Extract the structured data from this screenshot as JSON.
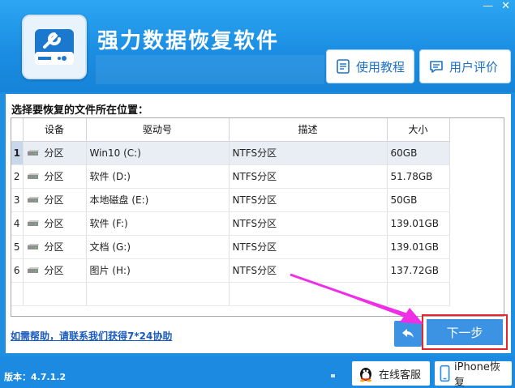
{
  "app": {
    "title": "强力数据恢复软件",
    "version": "版本：4.7.1.2"
  },
  "header": {
    "tutorial_label": "使用教程",
    "review_label": "用户评价"
  },
  "main": {
    "prompt": "选择要恢复的文件所在位置：",
    "columns": [
      "设备",
      "驱动号",
      "描述",
      "大小"
    ],
    "rows": [
      {
        "num": "1",
        "device": "分区",
        "drive": "Win10 (C:)",
        "desc": "NTFS分区",
        "size": "60GB"
      },
      {
        "num": "2",
        "device": "分区",
        "drive": "软件 (D:)",
        "desc": "NTFS分区",
        "size": "51.78GB"
      },
      {
        "num": "3",
        "device": "分区",
        "drive": "本地磁盘 (E:)",
        "desc": "NTFS分区",
        "size": "50GB"
      },
      {
        "num": "4",
        "device": "分区",
        "drive": "软件 (F:)",
        "desc": "NTFS分区",
        "size": "139.01GB"
      },
      {
        "num": "5",
        "device": "分区",
        "drive": "文档 (G:)",
        "desc": "NTFS分区",
        "size": "139.01GB"
      },
      {
        "num": "6",
        "device": "分区",
        "drive": "图片 (H:)",
        "desc": "NTFS分区",
        "size": "137.72GB"
      }
    ],
    "selected_row": 0,
    "help_link": "如需帮助，请联系我们获得7*24协助",
    "next_label": "下一步"
  },
  "footer": {
    "online_service_label": "在线客服",
    "iphone_recovery_label": "iPhone恢复"
  },
  "colors": {
    "header_blue": "#1b8ee3",
    "button_blue": "#3d93e3",
    "highlight_red": "#e5242c",
    "annotation_arrow": "#ee2fe6"
  }
}
